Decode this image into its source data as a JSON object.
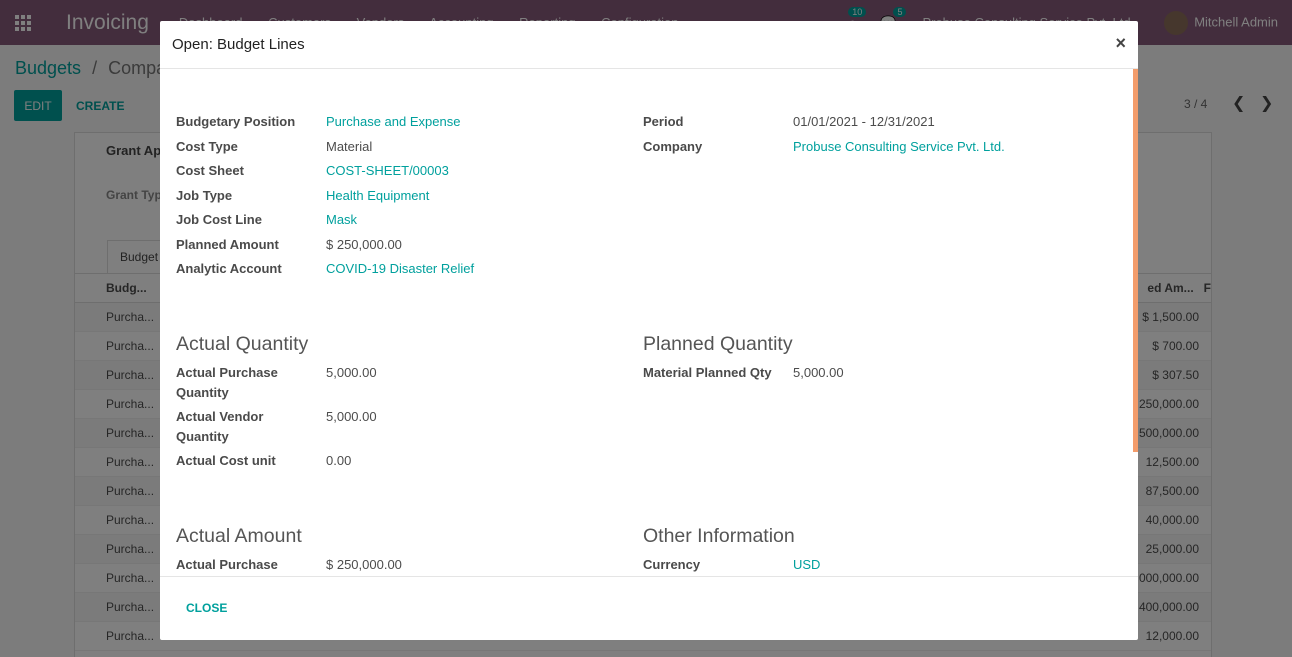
{
  "navbar": {
    "app_name": "Invoicing",
    "menu": [
      "Dashboard",
      "Customers",
      "Vendors",
      "Accounting",
      "Reporting",
      "Configuration"
    ],
    "activity_count": "10",
    "message_count": "5",
    "company": "Probuse Consulting Service Pvt. Ltd.",
    "user": "Mitchell Admin"
  },
  "control": {
    "breadcrumb_root": "Budgets",
    "breadcrumb_sep": "/",
    "breadcrumb_current": "Compa",
    "edit_label": "EDIT",
    "create_label": "CREATE",
    "pager": "3 / 4"
  },
  "background": {
    "label1": "Grant App",
    "label2": "Grant Typ",
    "tab": "Budget",
    "col1": "Budg...",
    "col_right": "ed Am...",
    "col_far": "F",
    "rows": [
      {
        "c1": "Purcha...",
        "amount": "$ 1,500.00"
      },
      {
        "c1": "Purcha...",
        "amount": "$ 700.00"
      },
      {
        "c1": "Purcha...",
        "amount": "$ 307.50"
      },
      {
        "c1": "Purcha...",
        "amount": "250,000.00"
      },
      {
        "c1": "Purcha...",
        "amount": "500,000.00"
      },
      {
        "c1": "Purcha...",
        "amount": "12,500.00"
      },
      {
        "c1": "Purcha...",
        "amount": "87,500.00"
      },
      {
        "c1": "Purcha...",
        "amount": "40,000.00"
      },
      {
        "c1": "Purcha...",
        "amount": "25,000.00"
      },
      {
        "c1": "Purcha...",
        "amount": "000,000.00"
      },
      {
        "c1": "Purcha...",
        "amount": "400,000.00"
      },
      {
        "c1": "Purcha...",
        "amount": "12,000.00"
      }
    ]
  },
  "modal": {
    "title": "Open: Budget Lines",
    "close_x": "×",
    "close_button": "CLOSE",
    "left_fields": [
      {
        "label": "Budgetary Position",
        "value": "Purchase and Expense"
      },
      {
        "label": "Cost Type",
        "value": "Material"
      },
      {
        "label": "Cost Sheet",
        "value": "COST-SHEET/00003"
      },
      {
        "label": "Job Type",
        "value": "Health Equipment"
      },
      {
        "label": "Job Cost Line",
        "value": "Mask"
      },
      {
        "label": "Planned Amount",
        "value": "$ 250,000.00"
      },
      {
        "label": "Analytic Account",
        "value": "COVID-19 Disaster Relief"
      }
    ],
    "right_fields": [
      {
        "label": "Period",
        "value": "01/01/2021 - 12/31/2021"
      },
      {
        "label": "Company",
        "value": "Probuse Consulting Service Pvt. Ltd."
      }
    ],
    "actual_quantity": {
      "title": "Actual Quantity",
      "fields": [
        {
          "label": "Actual Purchase Quantity",
          "value": "5,000.00"
        },
        {
          "label": "Actual Vendor Quantity",
          "value": "5,000.00"
        },
        {
          "label": "Actual Cost unit",
          "value": "0.00"
        }
      ]
    },
    "planned_quantity": {
      "title": "Planned Quantity",
      "fields": [
        {
          "label": "Material Planned Qty",
          "value": "5,000.00"
        }
      ]
    },
    "actual_amount": {
      "title": "Actual Amount",
      "fields": [
        {
          "label": "Actual Purchase",
          "value": "$ 250,000.00"
        }
      ]
    },
    "other_information": {
      "title": "Other Information",
      "fields": [
        {
          "label": "Currency",
          "value": "USD"
        }
      ]
    }
  },
  "colors": {
    "brand": "#875a7b",
    "accent": "#00a09d",
    "scrollbar": "#f39c6b"
  }
}
